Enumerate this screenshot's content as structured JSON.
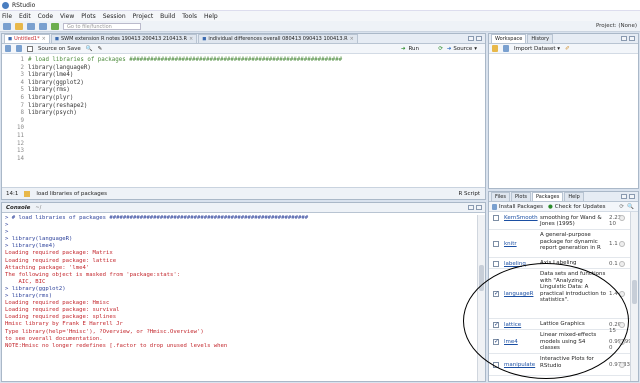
{
  "app": {
    "title": "RStudio"
  },
  "menu": [
    "File",
    "Edit",
    "Code",
    "View",
    "Plots",
    "Session",
    "Project",
    "Build",
    "Tools",
    "Help"
  ],
  "toolbar": {
    "goto_placeholder": "Go to file/function",
    "project": "Project: (None)"
  },
  "editor": {
    "tabs": [
      {
        "label": "Untitled1*",
        "active": true
      },
      {
        "label": "SWM extension R notes 190413 200413 210413.R",
        "active": false
      },
      {
        "label": "individual differences overall 080413 090413 100413.R",
        "active": false
      }
    ],
    "source_on_save": "Source on Save",
    "run": "Run",
    "source": "Source",
    "lines": [
      "",
      "",
      "",
      "# load libraries of packages #############################################################",
      "",
      "",
      "library(languageR)",
      "library(lme4)",
      "library(ggplot2)",
      "library(rms)",
      "library(plyr)",
      "library(reshape2)",
      "library(psych)",
      ""
    ],
    "status_pos": "14:1",
    "status_scope": "load libraries of packages",
    "status_type": "R Script"
  },
  "console": {
    "title": "Console",
    "path": "~/",
    "lines": [
      {
        "t": "> # load libraries of packages ###########################################################",
        "c": "cmd"
      },
      {
        "t": ">",
        "c": "cmd"
      },
      {
        "t": ">",
        "c": "cmd"
      },
      {
        "t": "> library(languageR)",
        "c": "cmd"
      },
      {
        "t": "> library(lme4)",
        "c": "cmd"
      },
      {
        "t": "Loading required package: Matrix",
        "c": "out"
      },
      {
        "t": "Loading required package: lattice",
        "c": "out"
      },
      {
        "t": "",
        "c": "out"
      },
      {
        "t": "Attaching package: 'lme4'",
        "c": "out"
      },
      {
        "t": "",
        "c": "out"
      },
      {
        "t": "The following object is masked from 'package:stats':",
        "c": "out"
      },
      {
        "t": "",
        "c": "out"
      },
      {
        "t": "    AIC, BIC",
        "c": "out"
      },
      {
        "t": "",
        "c": "out"
      },
      {
        "t": "> library(ggplot2)",
        "c": "cmd"
      },
      {
        "t": "> library(rms)",
        "c": "cmd"
      },
      {
        "t": "Loading required package: Hmisc",
        "c": "out"
      },
      {
        "t": "Loading required package: survival",
        "c": "out"
      },
      {
        "t": "Loading required package: splines",
        "c": "out"
      },
      {
        "t": "Hmisc library by Frank E Harrell Jr",
        "c": "out"
      },
      {
        "t": "",
        "c": "out"
      },
      {
        "t": "Type library(help='Hmisc'), ?Overview, or ?Hmisc.Overview')",
        "c": "out"
      },
      {
        "t": "to see overall documentation.",
        "c": "out"
      },
      {
        "t": "",
        "c": "out"
      },
      {
        "t": "NOTE:Hmisc no longer redefines [.factor to drop unused levels when",
        "c": "out"
      }
    ]
  },
  "workspace": {
    "tabs": [
      "Workspace",
      "History"
    ],
    "import": "Import Dataset"
  },
  "packages": {
    "tabs": [
      "Files",
      "Plots",
      "Packages",
      "Help"
    ],
    "install": "Install Packages",
    "check": "Check for Updates",
    "rows": [
      {
        "name": "KernSmooth",
        "desc": "Functions for kernel smoothing for Wand & Jones (1995)",
        "ver": "2.23-10",
        "checked": false
      },
      {
        "name": "knitr",
        "desc": "A general-purpose package for dynamic report generation in R",
        "ver": "1.1",
        "checked": false
      },
      {
        "name": "labeling",
        "desc": "Axis Labeling",
        "ver": "0.1",
        "checked": false
      },
      {
        "name": "languageR",
        "desc": "Data sets and functions with \"Analyzing Linguistic Data: A practical introduction to statistics\".",
        "ver": "1.4",
        "checked": true
      },
      {
        "name": "lattice",
        "desc": "Lattice Graphics",
        "ver": "0.20-15",
        "checked": true
      },
      {
        "name": "lme4",
        "desc": "Linear mixed-effects models using S4 classes",
        "ver": "0.999999-0",
        "checked": true
      },
      {
        "name": "manipulate",
        "desc": "Interactive Plots for RStudio",
        "ver": "0.97.336",
        "checked": false
      }
    ]
  }
}
